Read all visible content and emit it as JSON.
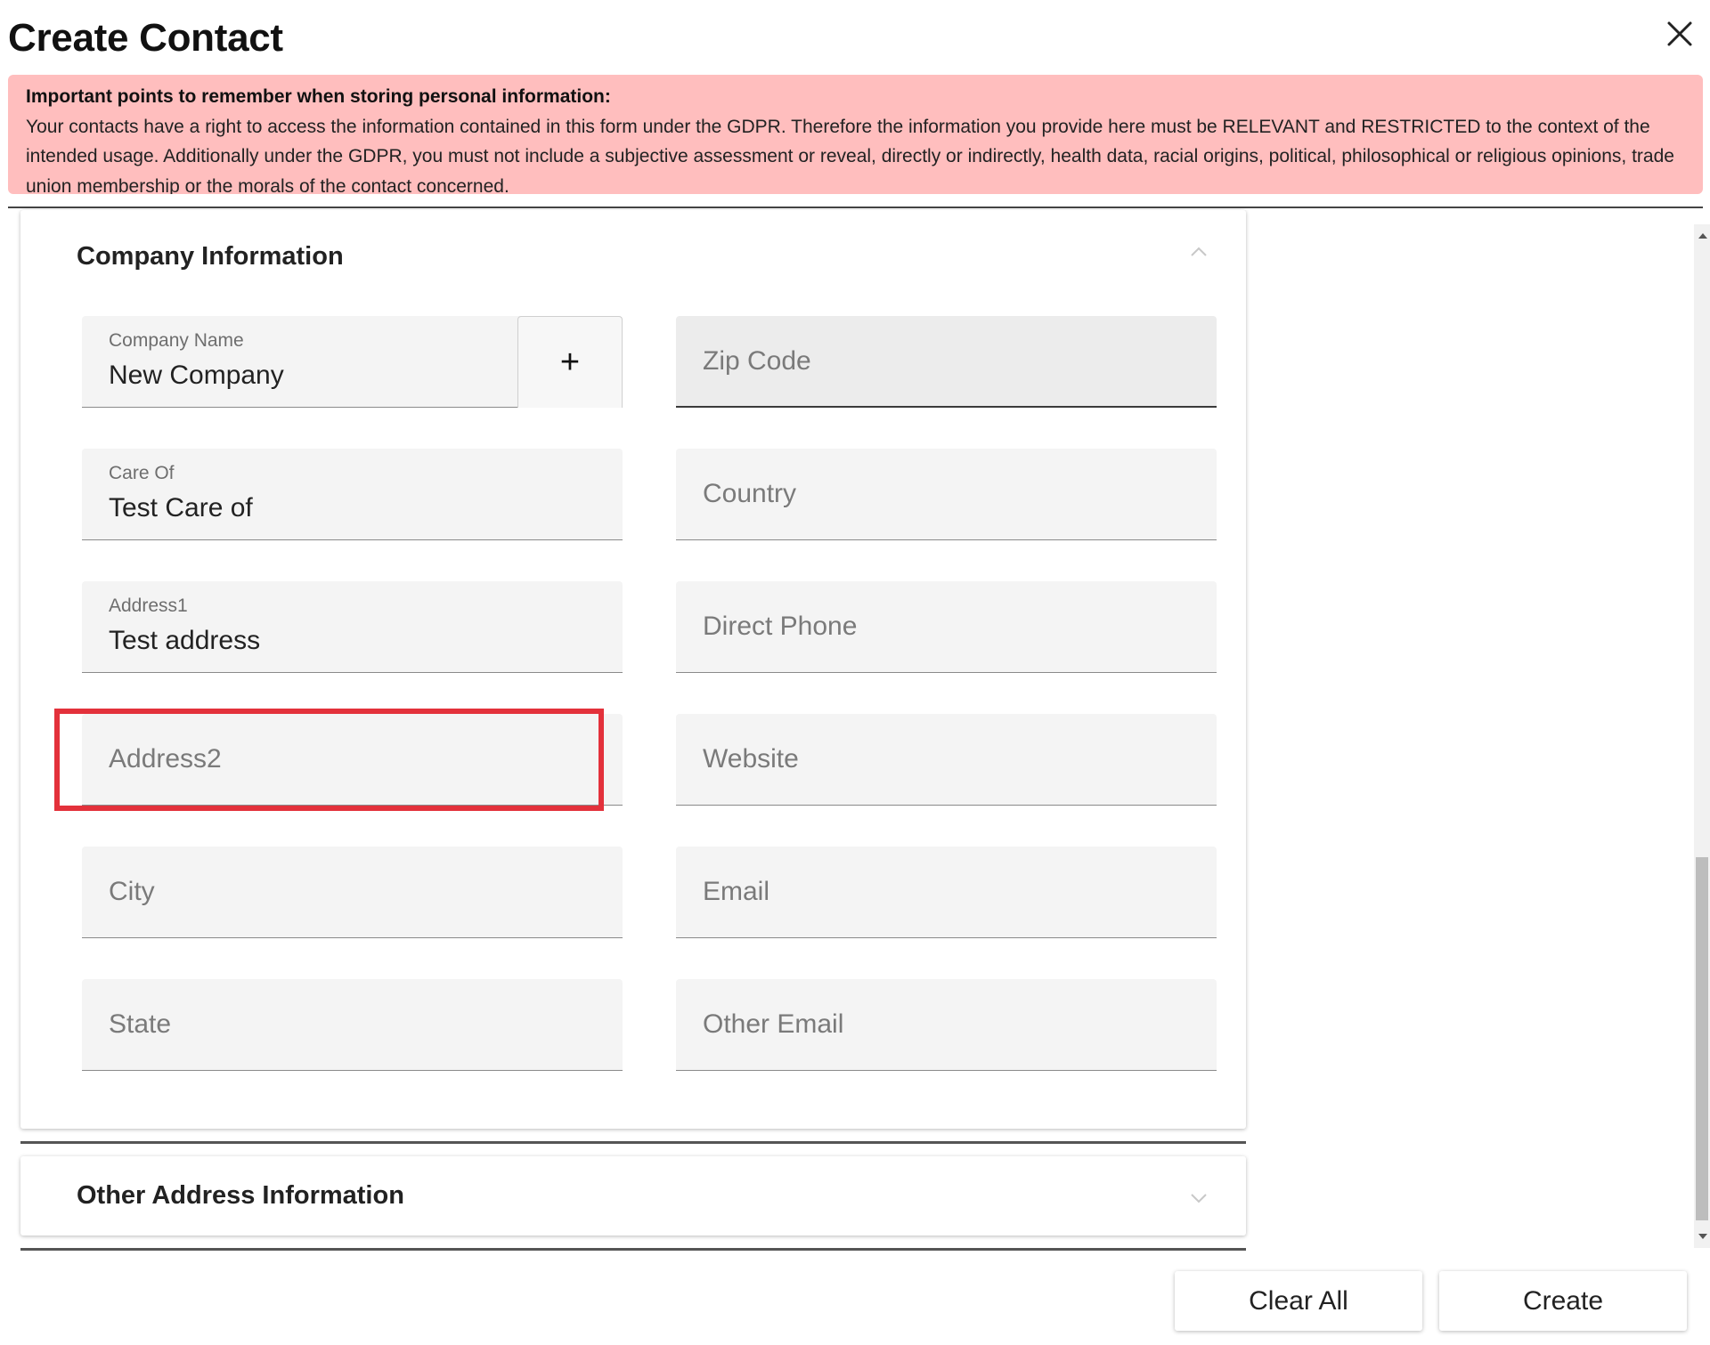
{
  "dialog": {
    "title": "Create Contact"
  },
  "notice": {
    "title": "Important points to remember when storing personal information:",
    "body": "Your contacts have a right to access the information contained in this form under the GDPR. Therefore the information you provide here must be RELEVANT and RESTRICTED to the context of the intended usage. Additionally under the GDPR, you must not include a subjective assessment or reveal, directly or indirectly, health data, racial origins, political, philosophical or religious opinions, trade union membership or the morals of the contact concerned."
  },
  "company_section": {
    "title": "Company Information",
    "expanded": true,
    "fields": {
      "company_name": {
        "label": "Company Name",
        "value": "New Company",
        "add_label": "+"
      },
      "care_of": {
        "label": "Care Of",
        "value": "Test Care of"
      },
      "address1": {
        "label": "Address1",
        "value": "Test address"
      },
      "address2": {
        "placeholder": "Address2",
        "value": ""
      },
      "city": {
        "placeholder": "City",
        "value": ""
      },
      "state": {
        "placeholder": "State",
        "value": ""
      },
      "zip_code": {
        "placeholder": "Zip Code",
        "value": ""
      },
      "country": {
        "placeholder": "Country",
        "value": ""
      },
      "direct_phone": {
        "placeholder": "Direct Phone",
        "value": ""
      },
      "website": {
        "placeholder": "Website",
        "value": ""
      },
      "email": {
        "placeholder": "Email",
        "value": ""
      },
      "other_email": {
        "placeholder": "Other Email",
        "value": ""
      }
    }
  },
  "other_address_section": {
    "title": "Other Address Information",
    "expanded": false
  },
  "footer": {
    "clear_label": "Clear All",
    "create_label": "Create"
  },
  "icons": {
    "close": "close-icon",
    "collapse": "chevron-up-icon",
    "expand": "chevron-down-icon"
  },
  "colors": {
    "notice_bg": "#ffbebe",
    "highlight": "#e3313b"
  }
}
